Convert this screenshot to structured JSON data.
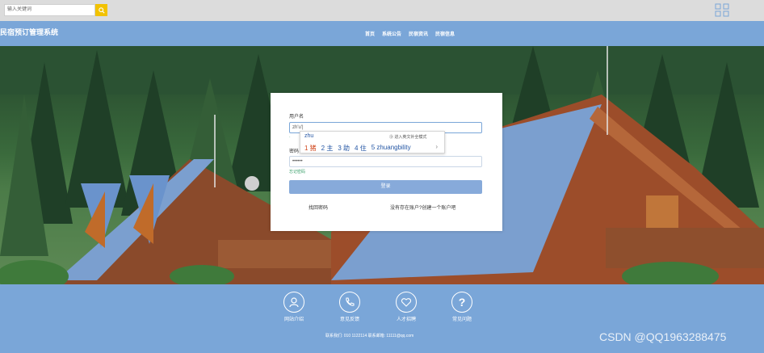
{
  "header": {
    "search_placeholder": "输入关键词"
  },
  "nav": {
    "site_title": "民宿预订管理系统",
    "items": [
      "首页",
      "系统公告",
      "民宿资讯",
      "民宿信息"
    ]
  },
  "login": {
    "username_label": "用户名",
    "username_value": "zh'u'|",
    "password_label": "密码",
    "password_value": "••••••",
    "forgot_link": "忘记密码",
    "login_button": "登录",
    "register_link_left": "找回密码",
    "register_link_right": "没有存在账户?创建一个账户吧"
  },
  "ime": {
    "composition": "zhu",
    "hint": "⑨ 进入英文补全模式",
    "candidates": [
      "1 猪",
      "2 主",
      "3 助",
      "4 住",
      "5 zhuangbility"
    ],
    "next": "›"
  },
  "footer": {
    "items": [
      {
        "label": "网站介绍",
        "icon": "user-icon"
      },
      {
        "label": "意见反馈",
        "icon": "phone-icon"
      },
      {
        "label": "人才招聘",
        "icon": "heart-icon"
      },
      {
        "label": "常见问题",
        "icon": "question-icon"
      }
    ],
    "contact": "联系我们: 010 1122114 联系邮箱: 11111@qq.com"
  },
  "watermark": "CSDN @QQ1963288475",
  "colors": {
    "nav_bg": "#7aa6d8",
    "search_button": "#f2c200",
    "login_button": "#87aada"
  }
}
